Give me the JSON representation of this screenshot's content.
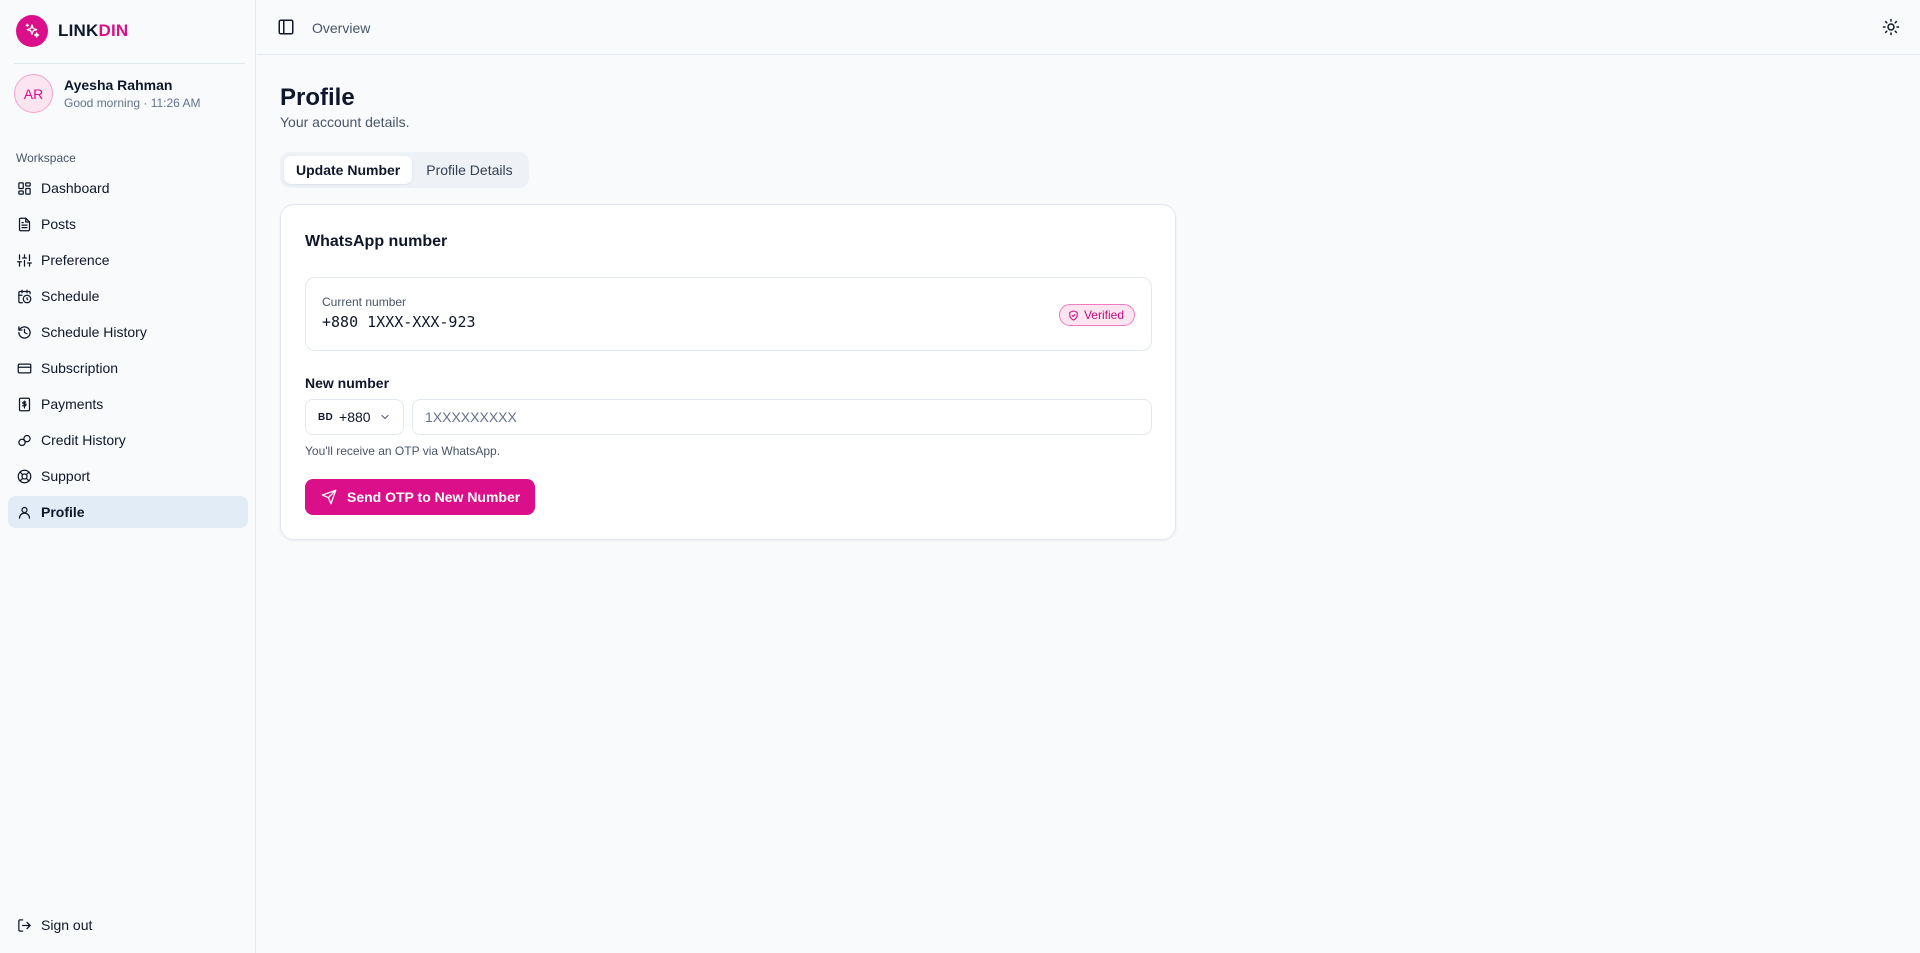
{
  "brand": {
    "name_part1": "LINK",
    "name_part2": "DIN",
    "accent": "#db0f8a"
  },
  "user": {
    "initials": "AR",
    "name": "Ayesha Rahman",
    "greeting": "Good morning · 11:26 AM"
  },
  "sidebar": {
    "section_label": "Workspace",
    "items": [
      {
        "label": "Dashboard",
        "icon": "dashboard-icon"
      },
      {
        "label": "Posts",
        "icon": "document-icon"
      },
      {
        "label": "Preference",
        "icon": "sliders-icon"
      },
      {
        "label": "Schedule",
        "icon": "calendar-clock-icon"
      },
      {
        "label": "Schedule History",
        "icon": "history-icon"
      },
      {
        "label": "Subscription",
        "icon": "credit-card-icon"
      },
      {
        "label": "Payments",
        "icon": "receipt-icon"
      },
      {
        "label": "Credit History",
        "icon": "link-icon"
      },
      {
        "label": "Support",
        "icon": "lifebuoy-icon"
      },
      {
        "label": "Profile",
        "icon": "user-icon",
        "active": true
      }
    ],
    "signout_label": "Sign out"
  },
  "topbar": {
    "breadcrumb": "Overview"
  },
  "page": {
    "title": "Profile",
    "subtitle": "Your account details.",
    "tabs": [
      {
        "label": "Update Number",
        "active": true
      },
      {
        "label": "Profile Details",
        "active": false
      }
    ]
  },
  "card": {
    "title": "WhatsApp number",
    "current_label": "Current number",
    "current_value": "+880 1XXX-XXX-923",
    "verified_label": "Verified",
    "new_label": "New number",
    "country_flag": "BD",
    "country_code": "+880",
    "phone_placeholder": "1XXXXXXXXX",
    "phone_value": "",
    "hint": "You'll receive an OTP via WhatsApp.",
    "send_button": "Send OTP to New Number"
  }
}
